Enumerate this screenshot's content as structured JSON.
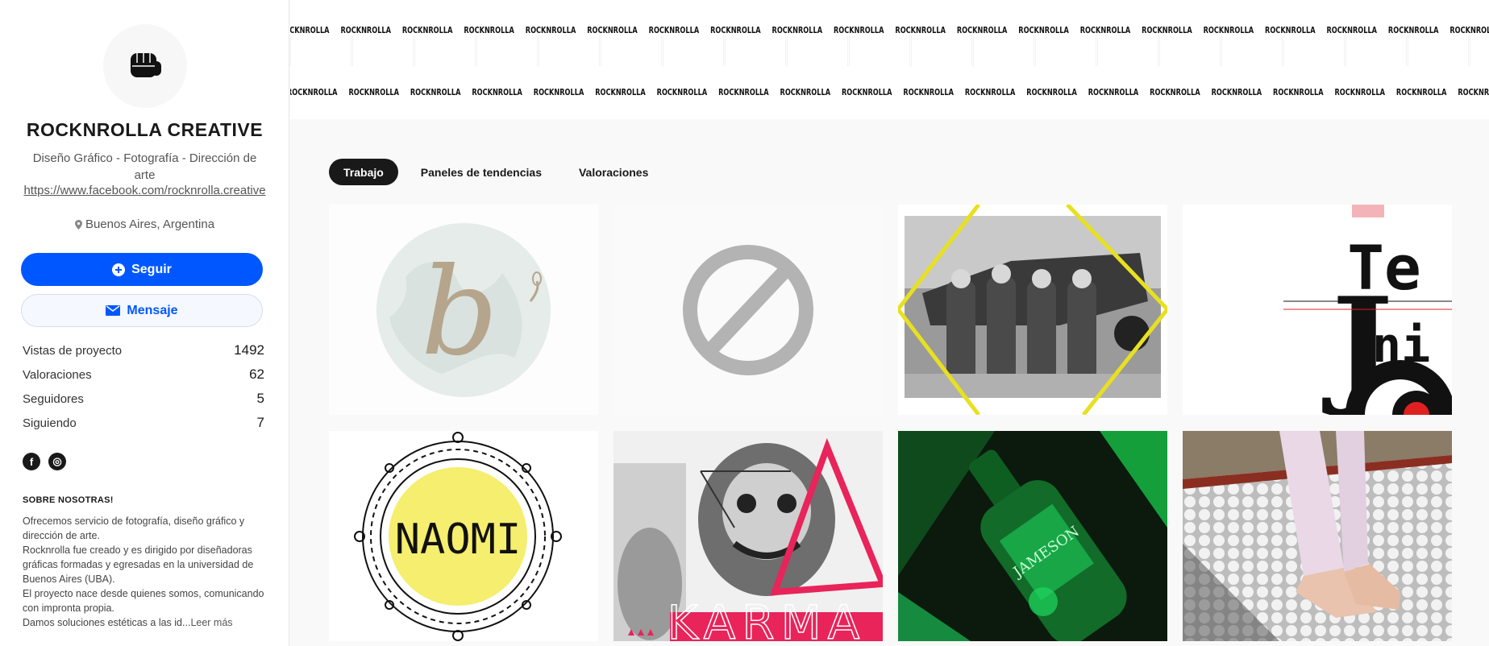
{
  "profile": {
    "name": "ROCKNROLLA CREATIVE",
    "tagline": "Diseño Gráfico - Fotografía - Dirección de arte",
    "link": "https://www.facebook.com/rocknrolla.creative",
    "location": "Buenos Aires, Argentina",
    "avatar_icon": "fist-icon"
  },
  "actions": {
    "follow_label": "Seguir",
    "message_label": "Mensaje"
  },
  "stats": [
    {
      "label": "Vistas de proyecto",
      "value": "1492"
    },
    {
      "label": "Valoraciones",
      "value": "62"
    },
    {
      "label": "Seguidores",
      "value": "5"
    },
    {
      "label": "Siguiendo",
      "value": "7"
    }
  ],
  "social": [
    {
      "name": "facebook-icon",
      "glyph": "f"
    },
    {
      "name": "instagram-icon",
      "glyph": "◎"
    }
  ],
  "about": {
    "title": "SOBRE NOSOTRAS!",
    "paragraphs": [
      "Ofrecemos servicio de fotografía, diseño gráfico y dirección de arte.",
      "Rocknrolla fue creado y es dirigido por diseñadoras gráficas formadas y egresadas en la universidad de Buenos Aires (UBA).",
      "El proyecto nace desde quienes somos, comunicando con impronta propia.",
      "Damos soluciones estéticas a las id..."
    ],
    "read_more": "Leer más"
  },
  "banner": {
    "word": "ROCKNROLLA"
  },
  "tabs": [
    {
      "label": "Trabajo",
      "active": true
    },
    {
      "label": "Paneles de tendencias",
      "active": false
    },
    {
      "label": "Valoraciones",
      "active": false
    }
  ],
  "projects": [
    {
      "name": "project-b-logo",
      "text": "b"
    },
    {
      "name": "project-unavailable",
      "text": ""
    },
    {
      "name": "project-aviators",
      "text": ""
    },
    {
      "name": "project-tenido",
      "text": "Te ni do"
    },
    {
      "name": "project-naomi",
      "text": "NAOMI"
    },
    {
      "name": "project-karma",
      "text": "KARMA"
    },
    {
      "name": "project-jameson",
      "text": "JAMESON"
    },
    {
      "name": "project-feet",
      "text": ""
    }
  ],
  "colors": {
    "accent": "#0057ff",
    "tab_active_bg": "#191919",
    "naomi_yellow": "#f5ee6e",
    "karma_pink": "#e8245a",
    "jameson_green": "#1ed760"
  }
}
